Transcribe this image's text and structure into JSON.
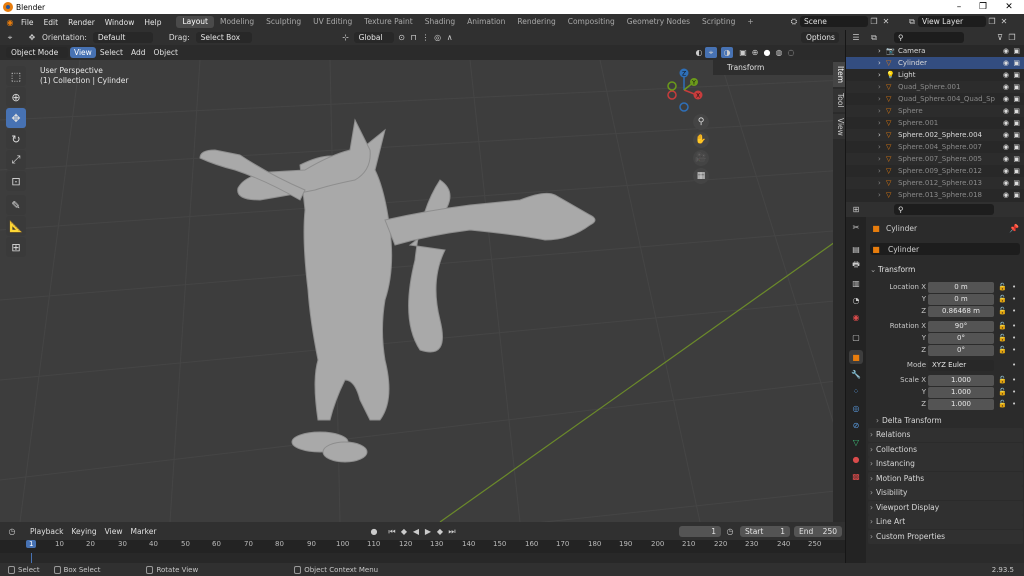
{
  "window": {
    "title": "Blender",
    "controls": [
      "–",
      "❐",
      "✕"
    ]
  },
  "menubar": {
    "menus": [
      "File",
      "Edit",
      "Render",
      "Window",
      "Help"
    ],
    "workspaces": [
      "Layout",
      "Modeling",
      "Sculpting",
      "UV Editing",
      "Texture Paint",
      "Shading",
      "Animation",
      "Rendering",
      "Compositing",
      "Geometry Nodes",
      "Scripting"
    ],
    "active_workspace": "Layout",
    "add_workspace": "+",
    "scene_label": "Scene",
    "view_layer_label": "View Layer"
  },
  "tool_header": {
    "orientation_label": "Orientation:",
    "orientation_value": "Default",
    "drag_label": "Drag:",
    "drag_value": "Select Box",
    "transform_orientation": "Global",
    "options_label": "Options"
  },
  "view_header": {
    "mode": "Object Mode",
    "menus": [
      "View",
      "Select",
      "Add",
      "Object"
    ],
    "active_menu": "View"
  },
  "viewport": {
    "perspective_text": "User Perspective",
    "collection_text": "(1) Collection | Cylinder",
    "npanel_section": "Transform",
    "npanel_tabs": [
      "Item",
      "Tool",
      "View"
    ],
    "gizmo_axes": {
      "x": "X",
      "y": "Y",
      "z": "Z"
    }
  },
  "timeline": {
    "menus": [
      "Playback",
      "Keying",
      "View",
      "Marker"
    ],
    "current_frame": "1",
    "start_label": "Start",
    "start_value": "1",
    "end_label": "End",
    "end_value": "250",
    "ruler": [
      "1",
      "10",
      "20",
      "30",
      "40",
      "50",
      "60",
      "70",
      "80",
      "90",
      "100",
      "110",
      "120",
      "130",
      "140",
      "150",
      "160",
      "170",
      "180",
      "190",
      "200",
      "210",
      "220",
      "230",
      "240",
      "250"
    ]
  },
  "statusbar": {
    "select": "Select",
    "box_select": "Box Select",
    "rotate_view": "Rotate View",
    "context_menu": "Object Context Menu",
    "version": "2.93.5"
  },
  "outliner": {
    "items": [
      {
        "name": "Camera",
        "type": "camera",
        "dim": false
      },
      {
        "name": "Cylinder",
        "type": "mesh",
        "dim": false
      },
      {
        "name": "Light",
        "type": "light",
        "dim": false
      },
      {
        "name": "Quad_Sphere.001",
        "type": "mesh",
        "dim": true
      },
      {
        "name": "Quad_Sphere.004_Quad_Sp",
        "type": "mesh",
        "dim": true
      },
      {
        "name": "Sphere",
        "type": "mesh",
        "dim": true
      },
      {
        "name": "Sphere.001",
        "type": "mesh",
        "dim": true
      },
      {
        "name": "Sphere.002_Sphere.004",
        "type": "mesh",
        "dim": false
      },
      {
        "name": "Sphere.004_Sphere.007",
        "type": "mesh",
        "dim": true
      },
      {
        "name": "Sphere.007_Sphere.005",
        "type": "mesh",
        "dim": true
      },
      {
        "name": "Sphere.009_Sphere.012",
        "type": "mesh",
        "dim": true
      },
      {
        "name": "Sphere.012_Sphere.013",
        "type": "mesh",
        "dim": true
      },
      {
        "name": "Sphere.013_Sphere.018",
        "type": "mesh",
        "dim": true
      }
    ]
  },
  "properties": {
    "object_name": "Cylinder",
    "data_name": "Cylinder",
    "transform_label": "Transform",
    "location_label": "Location X",
    "location": [
      "0 m",
      "0 m",
      "0.86468 m"
    ],
    "rotation_label": "Rotation X",
    "rotation": [
      "90°",
      "0°",
      "0°"
    ],
    "mode_label": "Mode",
    "mode_value": "XYZ Euler",
    "scale_label": "Scale X",
    "scale": [
      "1.000",
      "1.000",
      "1.000"
    ],
    "axis_y": "Y",
    "axis_z": "Z",
    "delta_transform": "Delta Transform",
    "sections": [
      "Relations",
      "Collections",
      "Instancing",
      "Motion Paths",
      "Visibility",
      "Viewport Display",
      "Line Art",
      "Custom Properties"
    ]
  },
  "colors": {
    "accent": "#4772b3",
    "grid_x": "#8c3a3a",
    "grid_y": "#6b8a2a",
    "mesh": "#a9a9a9"
  }
}
